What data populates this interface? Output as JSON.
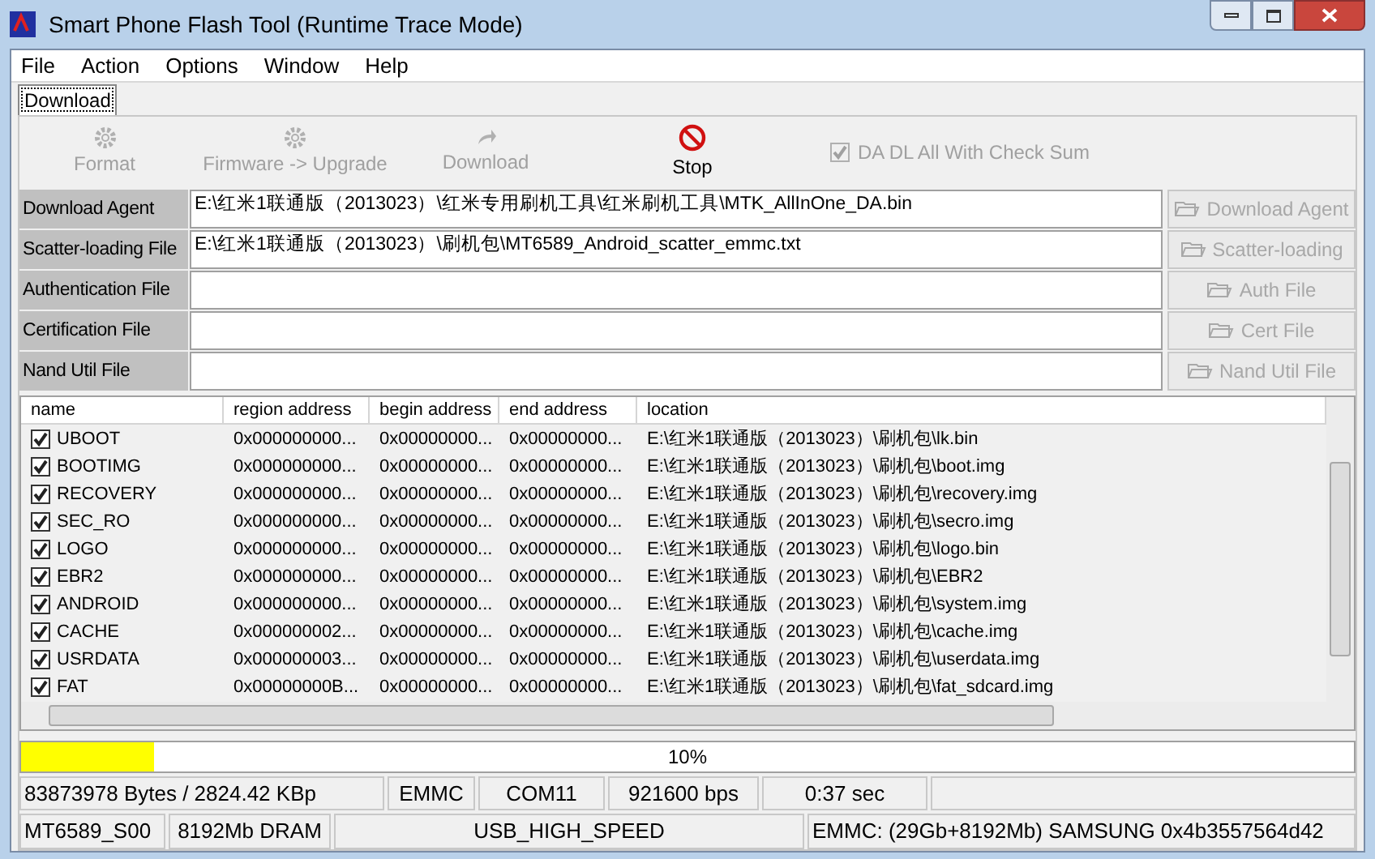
{
  "window": {
    "title": "Smart Phone Flash Tool (Runtime Trace Mode)"
  },
  "menu": [
    "File",
    "Action",
    "Options",
    "Window",
    "Help"
  ],
  "tabs": [
    {
      "label": "Download",
      "selected": true
    }
  ],
  "toolbar": [
    {
      "label": "Format",
      "kind": "format",
      "disabled": true
    },
    {
      "label": "Firmware -> Upgrade",
      "kind": "format",
      "disabled": true
    },
    {
      "label": "Download",
      "kind": "download",
      "disabled": true
    },
    {
      "label": "Stop",
      "kind": "stop",
      "disabled": false
    }
  ],
  "checksum": {
    "label": "DA DL All With Check Sum",
    "checked": true,
    "disabled": true
  },
  "files": [
    {
      "label": "Download Agent",
      "value": "E:\\红米1联通版（2013023）\\红米专用刷机工具\\红米刷机工具\\MTK_AllInOne_DA.bin",
      "button": "Download Agent",
      "disabled": true
    },
    {
      "label": "Scatter-loading File",
      "value": "E:\\红米1联通版（2013023）\\刷机包\\MT6589_Android_scatter_emmc.txt",
      "button": "Scatter-loading",
      "disabled": true
    },
    {
      "label": "Authentication File",
      "button": "Auth File",
      "disabled": true
    },
    {
      "label": "Certification File",
      "button": "Cert File",
      "disabled": true
    },
    {
      "label": "Nand Util File",
      "button": "Nand Util File",
      "disabled": true
    }
  ],
  "table": {
    "columns": [
      "name",
      "region address",
      "begin address",
      "end address",
      "location"
    ],
    "rows": [
      {
        "checked": true,
        "cells": [
          "UBOOT",
          "0x000000000...",
          "0x00000000...",
          "0x00000000...",
          "E:\\红米1联通版（2013023）\\刷机包\\lk.bin"
        ]
      },
      {
        "checked": true,
        "cells": [
          "BOOTIMG",
          "0x000000000...",
          "0x00000000...",
          "0x00000000...",
          "E:\\红米1联通版（2013023）\\刷机包\\boot.img"
        ]
      },
      {
        "checked": true,
        "cells": [
          "RECOVERY",
          "0x000000000...",
          "0x00000000...",
          "0x00000000...",
          "E:\\红米1联通版（2013023）\\刷机包\\recovery.img"
        ]
      },
      {
        "checked": true,
        "cells": [
          "SEC_RO",
          "0x000000000...",
          "0x00000000...",
          "0x00000000...",
          "E:\\红米1联通版（2013023）\\刷机包\\secro.img"
        ]
      },
      {
        "checked": true,
        "cells": [
          "LOGO",
          "0x000000000...",
          "0x00000000...",
          "0x00000000...",
          "E:\\红米1联通版（2013023）\\刷机包\\logo.bin"
        ]
      },
      {
        "checked": true,
        "cells": [
          "EBR2",
          "0x000000000...",
          "0x00000000...",
          "0x00000000...",
          "E:\\红米1联通版（2013023）\\刷机包\\EBR2"
        ]
      },
      {
        "checked": true,
        "cells": [
          "ANDROID",
          "0x000000000...",
          "0x00000000...",
          "0x00000000...",
          "E:\\红米1联通版（2013023）\\刷机包\\system.img"
        ]
      },
      {
        "checked": true,
        "cells": [
          "CACHE",
          "0x000000002...",
          "0x00000000...",
          "0x00000000...",
          "E:\\红米1联通版（2013023）\\刷机包\\cache.img"
        ]
      },
      {
        "checked": true,
        "cells": [
          "USRDATA",
          "0x000000003...",
          "0x00000000...",
          "0x00000000...",
          "E:\\红米1联通版（2013023）\\刷机包\\userdata.img"
        ]
      },
      {
        "checked": true,
        "cells": [
          "FAT",
          "0x00000000B...",
          "0x00000000...",
          "0x00000000...",
          "E:\\红米1联通版（2013023）\\刷机包\\fat_sdcard.img"
        ]
      }
    ]
  },
  "progress": {
    "level": 0.1,
    "text": "10%"
  },
  "status_rows": [
    [
      "83873978 Bytes / 2824.42 KBp",
      "EMMC",
      "COM11",
      "921600 bps",
      "0:37 sec",
      ""
    ],
    [
      "MT6589_S00",
      "8192Mb DRAM",
      "USB_HIGH_SPEED",
      "EMMC: (29Gb+8192Mb) SAMSUNG 0x4b3557564d42"
    ]
  ]
}
